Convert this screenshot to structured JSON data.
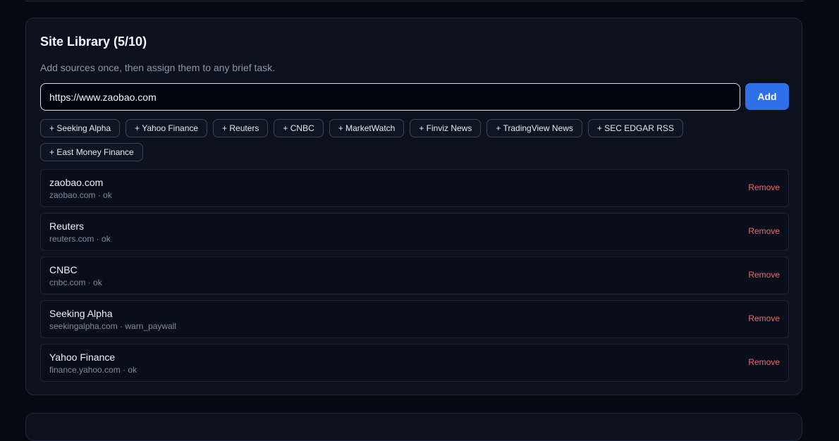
{
  "library": {
    "title": "Site Library (5/10)",
    "subtitle": "Add sources once, then assign them to any brief task.",
    "input_value": "https://www.zaobao.com",
    "add_label": "Add",
    "presets": [
      "+ Seeking Alpha",
      "+ Yahoo Finance",
      "+ Reuters",
      "+ CNBC",
      "+ MarketWatch",
      "+ Finviz News",
      "+ TradingView News",
      "+ SEC EDGAR RSS",
      "+ East Money Finance"
    ],
    "sites": [
      {
        "name": "zaobao.com",
        "meta": "zaobao.com · ok",
        "remove": "Remove"
      },
      {
        "name": "Reuters",
        "meta": "reuters.com · ok",
        "remove": "Remove"
      },
      {
        "name": "CNBC",
        "meta": "cnbc.com · ok",
        "remove": "Remove"
      },
      {
        "name": "Seeking Alpha",
        "meta": "seekingalpha.com · warn_paywall",
        "remove": "Remove"
      },
      {
        "name": "Yahoo Finance",
        "meta": "finance.yahoo.com · ok",
        "remove": "Remove"
      }
    ]
  },
  "colors": {
    "background": "#050912",
    "panel": "#0b111d",
    "accent": "#2f6fe8",
    "danger": "#f06a6a"
  }
}
